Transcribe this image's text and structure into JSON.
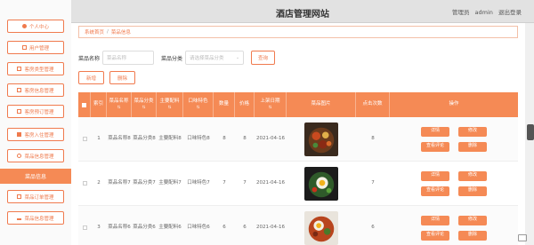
{
  "site_title": "酒店管理网站",
  "user": {
    "role": "管理员",
    "name": "admin",
    "logout": "退出登录"
  },
  "sidebar": {
    "items": [
      {
        "label": "个人中心"
      },
      {
        "label": "用户管理"
      },
      {
        "label": "客房类型管理"
      },
      {
        "label": "客房信息管理"
      },
      {
        "label": "客房预订管理"
      },
      {
        "label": "客房入住管理"
      },
      {
        "label": "菜品信息管理"
      },
      {
        "label": "菜品信息"
      },
      {
        "label": "菜品订单管理"
      },
      {
        "label": "菜品信息管理"
      }
    ],
    "active_label": "菜品信息"
  },
  "breadcrumb": {
    "home": "系统首页",
    "current": "菜品信息"
  },
  "search": {
    "name_label": "菜品名称",
    "name_placeholder": "菜品名称",
    "category_label": "菜品分类",
    "category_placeholder": "请选择菜品分类",
    "search_button": "查询"
  },
  "actions": {
    "add": "新增",
    "delete": "删除"
  },
  "table": {
    "headers": [
      "索引",
      "菜品名称",
      "菜品分类",
      "主要配料",
      "口味特色",
      "数量",
      "价格",
      "上架日期",
      "菜品图片",
      "点击次数",
      "操作"
    ],
    "rows": [
      {
        "index": "1",
        "name": "菜品名称8",
        "category": "菜品分类8",
        "ingredients": "主要配料8",
        "flavor": "口味特色8",
        "quantity": "8",
        "price": "8",
        "date": "2021-04-16",
        "clicks": "8"
      },
      {
        "index": "2",
        "name": "菜品名称7",
        "category": "菜品分类7",
        "ingredients": "主要配料7",
        "flavor": "口味特色7",
        "quantity": "7",
        "price": "7",
        "date": "2021-04-16",
        "clicks": "7"
      },
      {
        "index": "3",
        "name": "菜品名称6",
        "category": "菜品分类6",
        "ingredients": "主要配料6",
        "flavor": "口味特色6",
        "quantity": "6",
        "price": "6",
        "date": "2021-04-16",
        "clicks": "6"
      }
    ],
    "op_buttons": {
      "detail": "详情",
      "edit": "修改",
      "review": "查看评论",
      "delete": "删除"
    }
  },
  "colors": {
    "accent": "#f58a55",
    "accent_border": "#f07a4e"
  }
}
